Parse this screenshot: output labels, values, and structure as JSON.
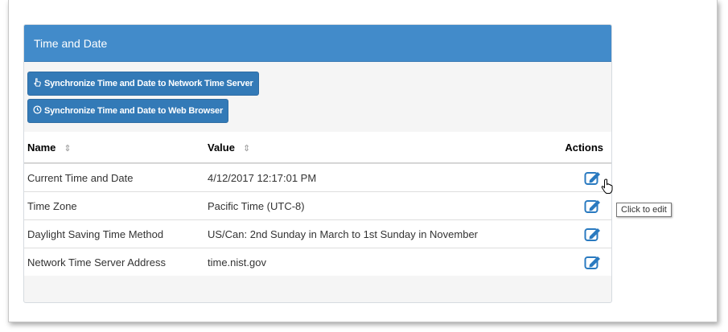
{
  "panel": {
    "title": "Time and Date",
    "buttons": [
      {
        "label": "Synchronize Time and Date to Network Time Server",
        "icon": "hand-pointer-icon"
      },
      {
        "label": "Synchronize Time and Date to Web Browser",
        "icon": "clock-icon"
      }
    ]
  },
  "table": {
    "headers": {
      "name": "Name",
      "value": "Value",
      "actions": "Actions"
    },
    "rows": [
      {
        "name": "Current Time and Date",
        "value": "4/12/2017 12:17:01 PM"
      },
      {
        "name": "Time Zone",
        "value": "Pacific Time (UTC-8)"
      },
      {
        "name": "Daylight Saving Time Method",
        "value": "US/Can: 2nd Sunday in March to 1st Sunday in November"
      },
      {
        "name": "Network Time Server Address",
        "value": "time.nist.gov"
      }
    ]
  },
  "tooltip": {
    "text": "Click to edit"
  },
  "colors": {
    "heading": "#428bca",
    "button": "#337ab7",
    "edit_icon": "#2a7ac0"
  }
}
